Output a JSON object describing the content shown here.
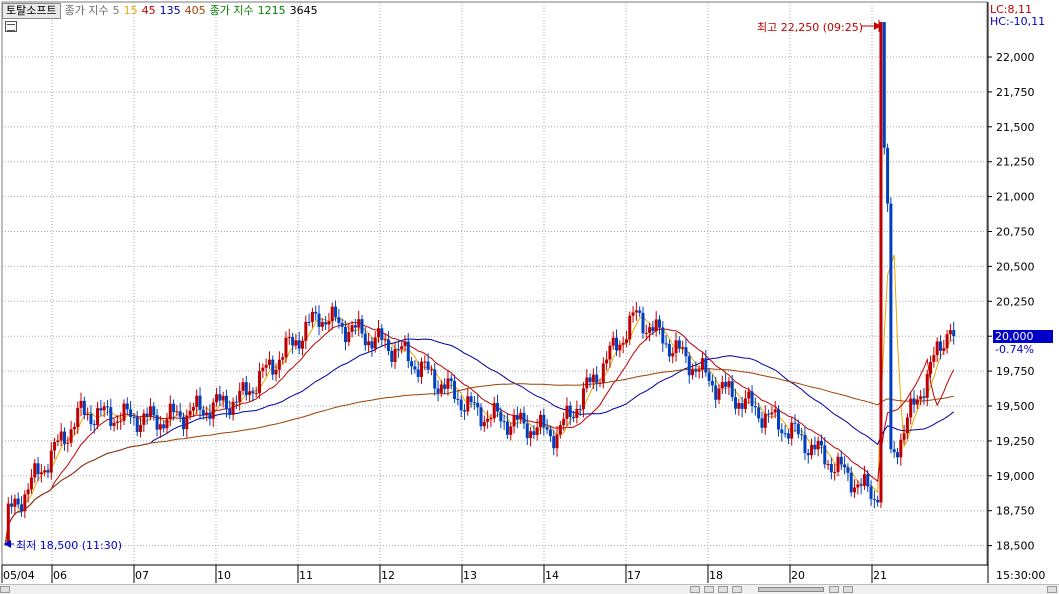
{
  "header": {
    "ticker": "토탈소프트",
    "vol_ma_label": "종가 지수",
    "ma": [
      {
        "value": "5",
        "color": "#7a7a7a"
      },
      {
        "value": "15",
        "color": "#e8a800"
      },
      {
        "value": "45",
        "color": "#c00000"
      },
      {
        "value": "135",
        "color": "#0000a0"
      },
      {
        "value": "405",
        "color": "#a04000"
      }
    ],
    "ma2_label": "종가 지수",
    "ma2": [
      {
        "value": "1215",
        "color": "#008000"
      },
      {
        "value": "3645",
        "color": "#000000"
      }
    ]
  },
  "axis": {
    "lc": "LC:8,11",
    "hc": "HC:-10,11",
    "current_price": "20,000",
    "change_pct": "-0.74%",
    "time": "15:30:00"
  },
  "markers": {
    "high": "최고 22,250 (09:25)",
    "low": "최저 18,500 (11:30)"
  },
  "colors": {
    "up": "#c00000",
    "down": "#0040c0",
    "grid": "#a8a8a8",
    "ma5": "#e8a800",
    "ma15": "#c00000",
    "ma45": "#0000a0",
    "ma135": "#a04000",
    "price_tag": "#0000c8"
  },
  "chart_data": {
    "type": "candlestick",
    "y_ticks": [
      "22,000",
      "21,750",
      "21,500",
      "21,250",
      "21,000",
      "20,750",
      "20,500",
      "20,250",
      "20,000",
      "19,750",
      "19,500",
      "19,250",
      "19,000",
      "18,750",
      "18,500"
    ],
    "y_tick_values": [
      22000,
      21750,
      21500,
      21250,
      21000,
      20750,
      20500,
      20250,
      20000,
      19750,
      19500,
      19250,
      19000,
      18750,
      18500
    ],
    "ylim": [
      18500,
      22250
    ],
    "x_ticks": [
      "05/04",
      "06",
      "07",
      "10",
      "11",
      "12",
      "13",
      "14",
      "17",
      "18",
      "20",
      "21"
    ],
    "day_close": [
      {
        "day": "05/04",
        "close": 19450
      },
      {
        "day": "06",
        "close": 19400
      },
      {
        "day": "07",
        "close": 19550
      },
      {
        "day": "10",
        "close": 20150
      },
      {
        "day": "11",
        "close": 19900
      },
      {
        "day": "12",
        "close": 19450
      },
      {
        "day": "13",
        "close": 19300
      },
      {
        "day": "14",
        "close": 20150
      },
      {
        "day": "17",
        "close": 19650
      },
      {
        "day": "18",
        "close": 19300
      },
      {
        "day": "20",
        "close": 18850
      },
      {
        "day": "21",
        "close": 20150
      }
    ],
    "high": 22250,
    "low": 18500,
    "last": 20000
  }
}
